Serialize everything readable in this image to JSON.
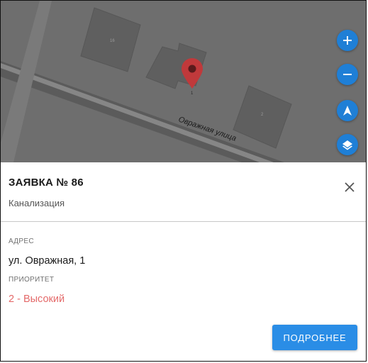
{
  "map": {
    "street_label": "Овражная улица",
    "house_labels": [
      "16",
      "1",
      "2"
    ]
  },
  "controls": {
    "zoom_in_icon": "plus-icon",
    "zoom_out_icon": "minus-icon",
    "locate_icon": "navigation-arrow-icon",
    "layers_icon": "layers-icon",
    "button_color": "#1f7fd6"
  },
  "request": {
    "title": "ЗАЯВКА № 86",
    "category": "Канализация",
    "address_label": "АДРЕС",
    "address": "ул. Овражная, 1",
    "priority_label": "ПРИОРИТЕТ",
    "priority": "2 - Высокий",
    "priority_color": "#e46a6a",
    "details_button": "ПОДРОБНЕЕ"
  }
}
